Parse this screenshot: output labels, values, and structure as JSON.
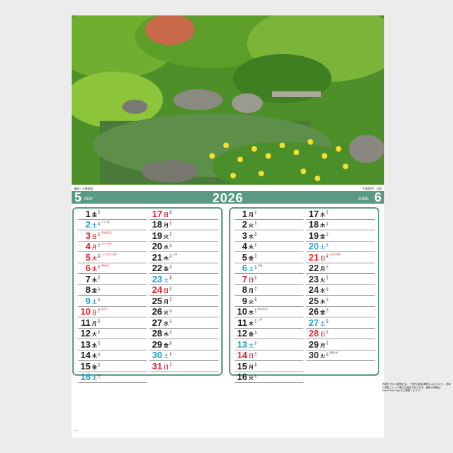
{
  "page": {
    "year": "2026",
    "left_month_number": "5",
    "left_month_name": "MAY",
    "right_month_number": "6",
    "right_month_name": "JUNE",
    "caption_left": "福岡 / 小原庭園",
    "caption_right": "写真提供　吉田",
    "note": "西暦日付の六曜表記は、一般的な暦の解釈によるもので、地域や資料によって異なる場合があります。最新の情報は https://koyomi.jp をご確認ください。",
    "footer": "48"
  },
  "may": {
    "col1": [
      {
        "d": "1",
        "w": "金",
        "r": "先負",
        "e": "",
        "c": "black"
      },
      {
        "d": "2",
        "w": "土",
        "r": "仏滅",
        "e": "八十八夜",
        "c": "blue"
      },
      {
        "d": "3",
        "w": "日",
        "r": "大安",
        "e": "憲法記念日",
        "c": "red"
      },
      {
        "d": "4",
        "w": "月",
        "r": "赤口",
        "e": "みどりの日",
        "c": "red"
      },
      {
        "d": "5",
        "w": "火",
        "r": "先勝",
        "e": "こどもの日 立夏",
        "c": "red"
      },
      {
        "d": "6",
        "w": "水",
        "r": "友引",
        "e": "振替休日",
        "c": "red"
      },
      {
        "d": "7",
        "w": "木",
        "r": "先負",
        "e": "",
        "c": "black"
      },
      {
        "d": "8",
        "w": "金",
        "r": "仏滅",
        "e": "",
        "c": "black"
      },
      {
        "d": "9",
        "w": "土",
        "r": "大安",
        "e": "",
        "c": "blue"
      },
      {
        "d": "10",
        "w": "日",
        "r": "赤口",
        "e": "母の日",
        "c": "red"
      },
      {
        "d": "11",
        "w": "月",
        "r": "先勝",
        "e": "",
        "c": "black"
      },
      {
        "d": "12",
        "w": "火",
        "r": "友引",
        "e": "",
        "c": "black"
      },
      {
        "d": "13",
        "w": "水",
        "r": "先負",
        "e": "",
        "c": "black"
      },
      {
        "d": "14",
        "w": "木",
        "r": "仏滅",
        "e": "",
        "c": "black"
      },
      {
        "d": "15",
        "w": "金",
        "r": "大安",
        "e": "",
        "c": "black"
      },
      {
        "d": "16",
        "w": "土",
        "r": "赤口",
        "e": "",
        "c": "blue"
      }
    ],
    "col2": [
      {
        "d": "17",
        "w": "日",
        "r": "先勝",
        "e": "",
        "c": "red"
      },
      {
        "d": "18",
        "w": "月",
        "r": "友引",
        "e": "",
        "c": "black"
      },
      {
        "d": "19",
        "w": "火",
        "r": "先負",
        "e": "",
        "c": "black"
      },
      {
        "d": "20",
        "w": "水",
        "r": "仏滅",
        "e": "",
        "c": "black"
      },
      {
        "d": "21",
        "w": "木",
        "r": "大安",
        "e": "小満",
        "c": "black"
      },
      {
        "d": "22",
        "w": "金",
        "r": "赤口",
        "e": "",
        "c": "black"
      },
      {
        "d": "23",
        "w": "土",
        "r": "先勝",
        "e": "",
        "c": "blue"
      },
      {
        "d": "24",
        "w": "日",
        "r": "友引",
        "e": "",
        "c": "red"
      },
      {
        "d": "25",
        "w": "月",
        "r": "先負",
        "e": "",
        "c": "black"
      },
      {
        "d": "26",
        "w": "火",
        "r": "仏滅",
        "e": "",
        "c": "black"
      },
      {
        "d": "27",
        "w": "水",
        "r": "大安",
        "e": "",
        "c": "black"
      },
      {
        "d": "28",
        "w": "木",
        "r": "赤口",
        "e": "",
        "c": "black"
      },
      {
        "d": "29",
        "w": "金",
        "r": "先勝",
        "e": "",
        "c": "black"
      },
      {
        "d": "30",
        "w": "土",
        "r": "友引",
        "e": "",
        "c": "blue"
      },
      {
        "d": "31",
        "w": "日",
        "r": "先負",
        "e": "",
        "c": "red"
      }
    ]
  },
  "june": {
    "col1": [
      {
        "d": "1",
        "w": "月",
        "r": "大安",
        "e": "",
        "c": "black"
      },
      {
        "d": "2",
        "w": "火",
        "r": "赤口",
        "e": "",
        "c": "black"
      },
      {
        "d": "3",
        "w": "水",
        "r": "先勝",
        "e": "",
        "c": "black"
      },
      {
        "d": "4",
        "w": "木",
        "r": "友引",
        "e": "",
        "c": "black"
      },
      {
        "d": "5",
        "w": "金",
        "r": "先負",
        "e": "",
        "c": "black"
      },
      {
        "d": "6",
        "w": "土",
        "r": "仏滅",
        "e": "芒種",
        "c": "blue"
      },
      {
        "d": "7",
        "w": "日",
        "r": "大安",
        "e": "",
        "c": "red"
      },
      {
        "d": "8",
        "w": "月",
        "r": "赤口",
        "e": "",
        "c": "black"
      },
      {
        "d": "9",
        "w": "火",
        "r": "先勝",
        "e": "",
        "c": "black"
      },
      {
        "d": "10",
        "w": "水",
        "r": "友引",
        "e": "時の記念日",
        "c": "black"
      },
      {
        "d": "11",
        "w": "木",
        "r": "先負",
        "e": "入梅",
        "c": "black"
      },
      {
        "d": "12",
        "w": "金",
        "r": "仏滅",
        "e": "",
        "c": "black"
      },
      {
        "d": "13",
        "w": "土",
        "r": "大安",
        "e": "",
        "c": "blue"
      },
      {
        "d": "14",
        "w": "日",
        "r": "赤口",
        "e": "",
        "c": "red"
      },
      {
        "d": "15",
        "w": "月",
        "r": "先勝",
        "e": "",
        "c": "black"
      },
      {
        "d": "16",
        "w": "火",
        "r": "友引",
        "e": "",
        "c": "black"
      }
    ],
    "col2": [
      {
        "d": "17",
        "w": "水",
        "r": "先負",
        "e": "",
        "c": "black"
      },
      {
        "d": "18",
        "w": "木",
        "r": "仏滅",
        "e": "",
        "c": "black"
      },
      {
        "d": "19",
        "w": "金",
        "r": "大安",
        "e": "",
        "c": "black"
      },
      {
        "d": "20",
        "w": "土",
        "r": "赤口",
        "e": "",
        "c": "blue"
      },
      {
        "d": "21",
        "w": "日",
        "r": "先勝",
        "e": "父の日 夏至",
        "c": "red"
      },
      {
        "d": "22",
        "w": "月",
        "r": "友引",
        "e": "",
        "c": "black"
      },
      {
        "d": "23",
        "w": "火",
        "r": "先負",
        "e": "",
        "c": "black"
      },
      {
        "d": "24",
        "w": "水",
        "r": "仏滅",
        "e": "",
        "c": "black"
      },
      {
        "d": "25",
        "w": "木",
        "r": "大安",
        "e": "",
        "c": "black"
      },
      {
        "d": "26",
        "w": "金",
        "r": "赤口",
        "e": "",
        "c": "black"
      },
      {
        "d": "27",
        "w": "土",
        "r": "先勝",
        "e": "",
        "c": "blue"
      },
      {
        "d": "28",
        "w": "日",
        "r": "友引",
        "e": "",
        "c": "red"
      },
      {
        "d": "29",
        "w": "月",
        "r": "先負",
        "e": "",
        "c": "black"
      },
      {
        "d": "30",
        "w": "火",
        "r": "仏滅",
        "e": "夏越の祓",
        "c": "black"
      }
    ]
  }
}
